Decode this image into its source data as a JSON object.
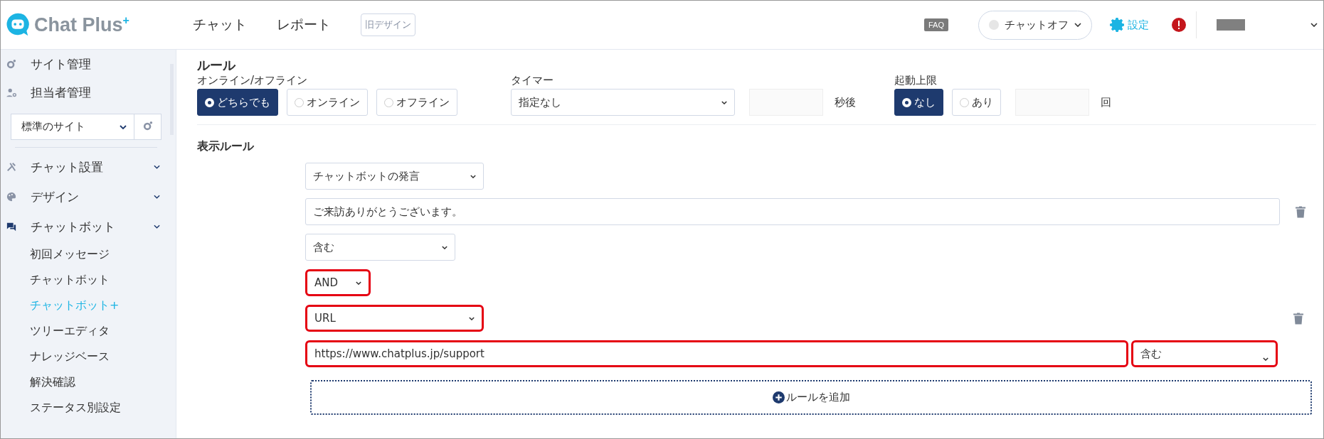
{
  "header": {
    "logo_text": "Chat Plus",
    "logo_sup": "+",
    "nav": [
      {
        "label": "チャット"
      },
      {
        "label": "レポート"
      }
    ],
    "old_design": "旧デザイン",
    "faq": "FAQ",
    "chat_status": {
      "label": "チャットオフ",
      "online": false
    },
    "settings": "設定"
  },
  "sidebar": {
    "top_items": [
      {
        "label": "サイト管理"
      },
      {
        "label": "担当者管理"
      }
    ],
    "site_select": "標準のサイト",
    "menu": [
      {
        "label": "チャット設置",
        "expanded": false
      },
      {
        "label": "デザイン",
        "expanded": false
      },
      {
        "label": "チャットボット",
        "expanded": true,
        "children": [
          {
            "label": "初回メッセージ",
            "selected": false
          },
          {
            "label": "チャットボット",
            "selected": false
          },
          {
            "label": "チャットボット+",
            "selected": true
          },
          {
            "label": "ツリーエディタ",
            "selected": false
          },
          {
            "label": "ナレッジベース",
            "selected": false
          },
          {
            "label": "解決確認",
            "selected": false
          },
          {
            "label": "ステータス別設定",
            "selected": false
          }
        ]
      }
    ]
  },
  "rule": {
    "title": "ルール",
    "online_label": "オンライン/オフライン",
    "online_options": [
      {
        "label": "どちらでも",
        "selected": true
      },
      {
        "label": "オンライン",
        "selected": false
      },
      {
        "label": "オフライン",
        "selected": false
      }
    ],
    "timer_label": "タイマー",
    "timer_value": "指定なし",
    "seconds_unit": "秒後",
    "limit_label": "起動上限",
    "limit_options": [
      {
        "label": "なし",
        "selected": true
      },
      {
        "label": "あり",
        "selected": false
      }
    ],
    "count_unit": "回"
  },
  "display_rules": {
    "title": "表示ルール",
    "conditions": [
      {
        "kind": "text",
        "type": {
          "value": "チャットボットの発言",
          "highlighted": false
        },
        "value": {
          "value": "ご来訪ありがとうございます。",
          "highlighted": false
        },
        "match": {
          "value": "含む",
          "highlighted": false
        }
      },
      {
        "kind": "url",
        "operator": {
          "value": "AND",
          "highlighted": true
        },
        "type": {
          "value": "URL",
          "highlighted": true
        },
        "value": {
          "value": "https://www.chatplus.jp/support",
          "highlighted": true
        },
        "match": {
          "value": "含む",
          "highlighted": true
        }
      }
    ],
    "add_rule": "ルールを追加"
  }
}
